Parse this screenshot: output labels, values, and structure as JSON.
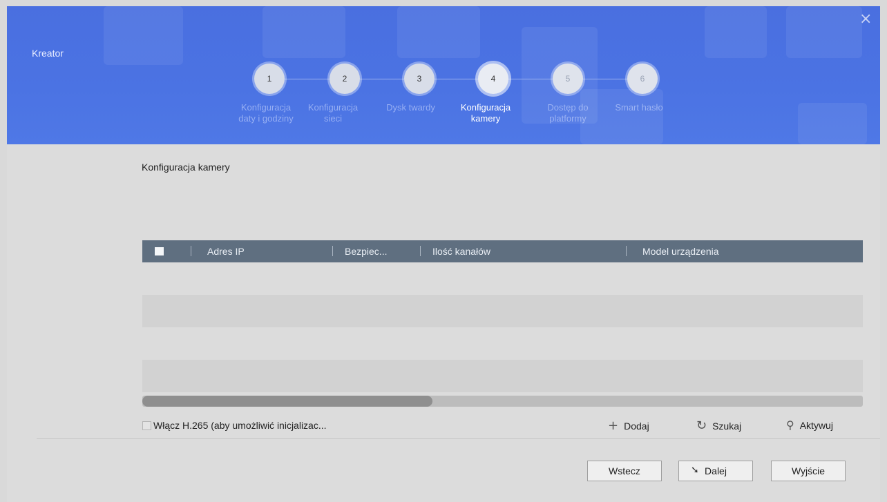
{
  "wizard": {
    "title": "Kreator",
    "close_icon": "close-icon",
    "steps": [
      {
        "number": "1",
        "label": "Konfiguracja daty i godziny",
        "state": "done"
      },
      {
        "number": "2",
        "label": "Konfiguracja sieci",
        "state": "done"
      },
      {
        "number": "3",
        "label": "Dysk twardy",
        "state": "done"
      },
      {
        "number": "4",
        "label": "Konfiguracja kamery",
        "state": "active"
      },
      {
        "number": "5",
        "label": "Dostęp do platformy",
        "state": "future"
      },
      {
        "number": "6",
        "label": "Smart hasło",
        "state": "future"
      }
    ]
  },
  "main": {
    "title": "Konfiguracja kamery",
    "table": {
      "columns": [
        "Adres IP",
        "Bezpiec...",
        "Ilość kanałów",
        "Model urządzenia"
      ],
      "rows": []
    },
    "h265_label": "Włącz H.265 (aby umożliwić inicjalizac...",
    "actions": {
      "add": {
        "label": "Dodaj",
        "icon": "plus-icon"
      },
      "search": {
        "label": "Szukaj",
        "icon": "refresh-icon"
      },
      "activate": {
        "label": "Aktywuj",
        "icon": "search-icon"
      }
    }
  },
  "footer": {
    "back": "Wstecz",
    "next": "Dalej",
    "exit": "Wyjście"
  },
  "colors": {
    "header": "#4b73e3",
    "table_header": "#5f6f80",
    "background": "#dcdcdc"
  }
}
